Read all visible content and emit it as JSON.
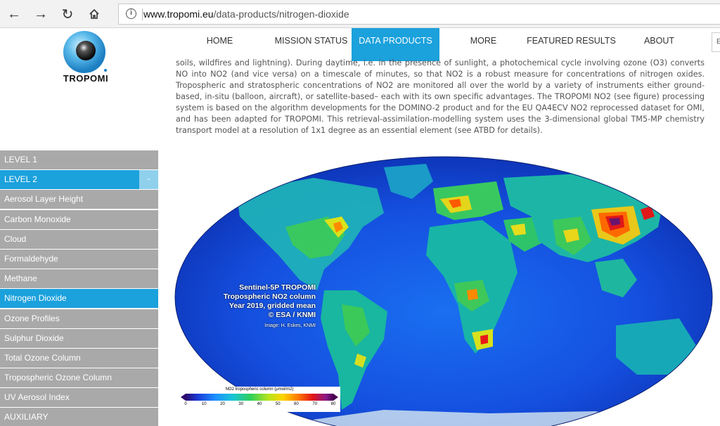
{
  "browser": {
    "url_domain": "www.tropomi.eu",
    "url_path": "/data-products/nitrogen-dioxide",
    "info_icon": "i"
  },
  "site": {
    "logo_text": "TROPOMI",
    "nav": [
      "HOME",
      "MISSION STATUS",
      "DATA PRODUCTS",
      "MORE",
      "FEATURED RESULTS",
      "ABOUT"
    ],
    "active_nav": "DATA PRODUCTS",
    "search_partial": "E"
  },
  "article": {
    "partial_line": "r  g      ,        ,      d  ,      d        ,   ,      ,   d      ,   d      g    ,      ,   ,  g   ,          g   ,            d",
    "paragraph": "soils, wildfires and lightning). During daytime, i.e. in the presence of sunlight, a photochemical cycle involving ozone (O3) converts NO into NO2 (and vice versa) on a timescale of minutes, so that NO2 is a robust measure for concentrations of nitrogen oxides. Tropospheric and stratospheric concentrations of NO2 are monitored all over the world by a variety of instruments either ground-based, in-situ (balloon, aircraft), or satellite-based– each with its own specific advantages. The TROPOMI NO2 (see figure) processing system is based on the algorithm developments for the DOMINO-2 product and for the EU QA4ECV NO2 reprocessed dataset for OMI, and has been adapted for TROPOMI. This retrieval-assimilation-modelling system uses the 3-dimensional global TM5-MP chemistry transport model at a resolution of 1x1 degree as an essential element (see ATBD for details)."
  },
  "sidebar": {
    "items": [
      {
        "label": "LEVEL 1",
        "state": "normal"
      },
      {
        "label": "LEVEL 2",
        "state": "level2"
      },
      {
        "label": "Aerosol Layer Height",
        "state": "normal"
      },
      {
        "label": "Carbon Monoxide",
        "state": "normal"
      },
      {
        "label": "Cloud",
        "state": "normal"
      },
      {
        "label": "Formaldehyde",
        "state": "normal"
      },
      {
        "label": "Methane",
        "state": "normal"
      },
      {
        "label": "Nitrogen Dioxide",
        "state": "active"
      },
      {
        "label": "Ozone Profiles",
        "state": "normal"
      },
      {
        "label": "Sulphur Dioxide",
        "state": "normal"
      },
      {
        "label": "Total Ozone Column",
        "state": "normal"
      },
      {
        "label": "Tropospheric Ozone Column",
        "state": "normal"
      },
      {
        "label": "UV Aerosol Index",
        "state": "normal"
      },
      {
        "label": "AUXILIARY",
        "state": "normal"
      }
    ],
    "collapse_symbol": "-"
  },
  "figure": {
    "caption_lines": [
      "Sentinel-5P TROPOMI",
      "Tropospheric NO2 column",
      "Year 2019, gridded mean",
      "© ESA / KNMI"
    ],
    "credit": "Image: H. Eskes, KNMI",
    "colorbar_title": "NO2 tropospheric column (μmol/m2)",
    "colorbar_ticks": [
      "0",
      "10",
      "20",
      "30",
      "40",
      "50",
      "60",
      "70",
      "80"
    ]
  },
  "colors": {
    "accent": "#1ba1dc",
    "sidebar_bg": "#a9a9a9"
  }
}
